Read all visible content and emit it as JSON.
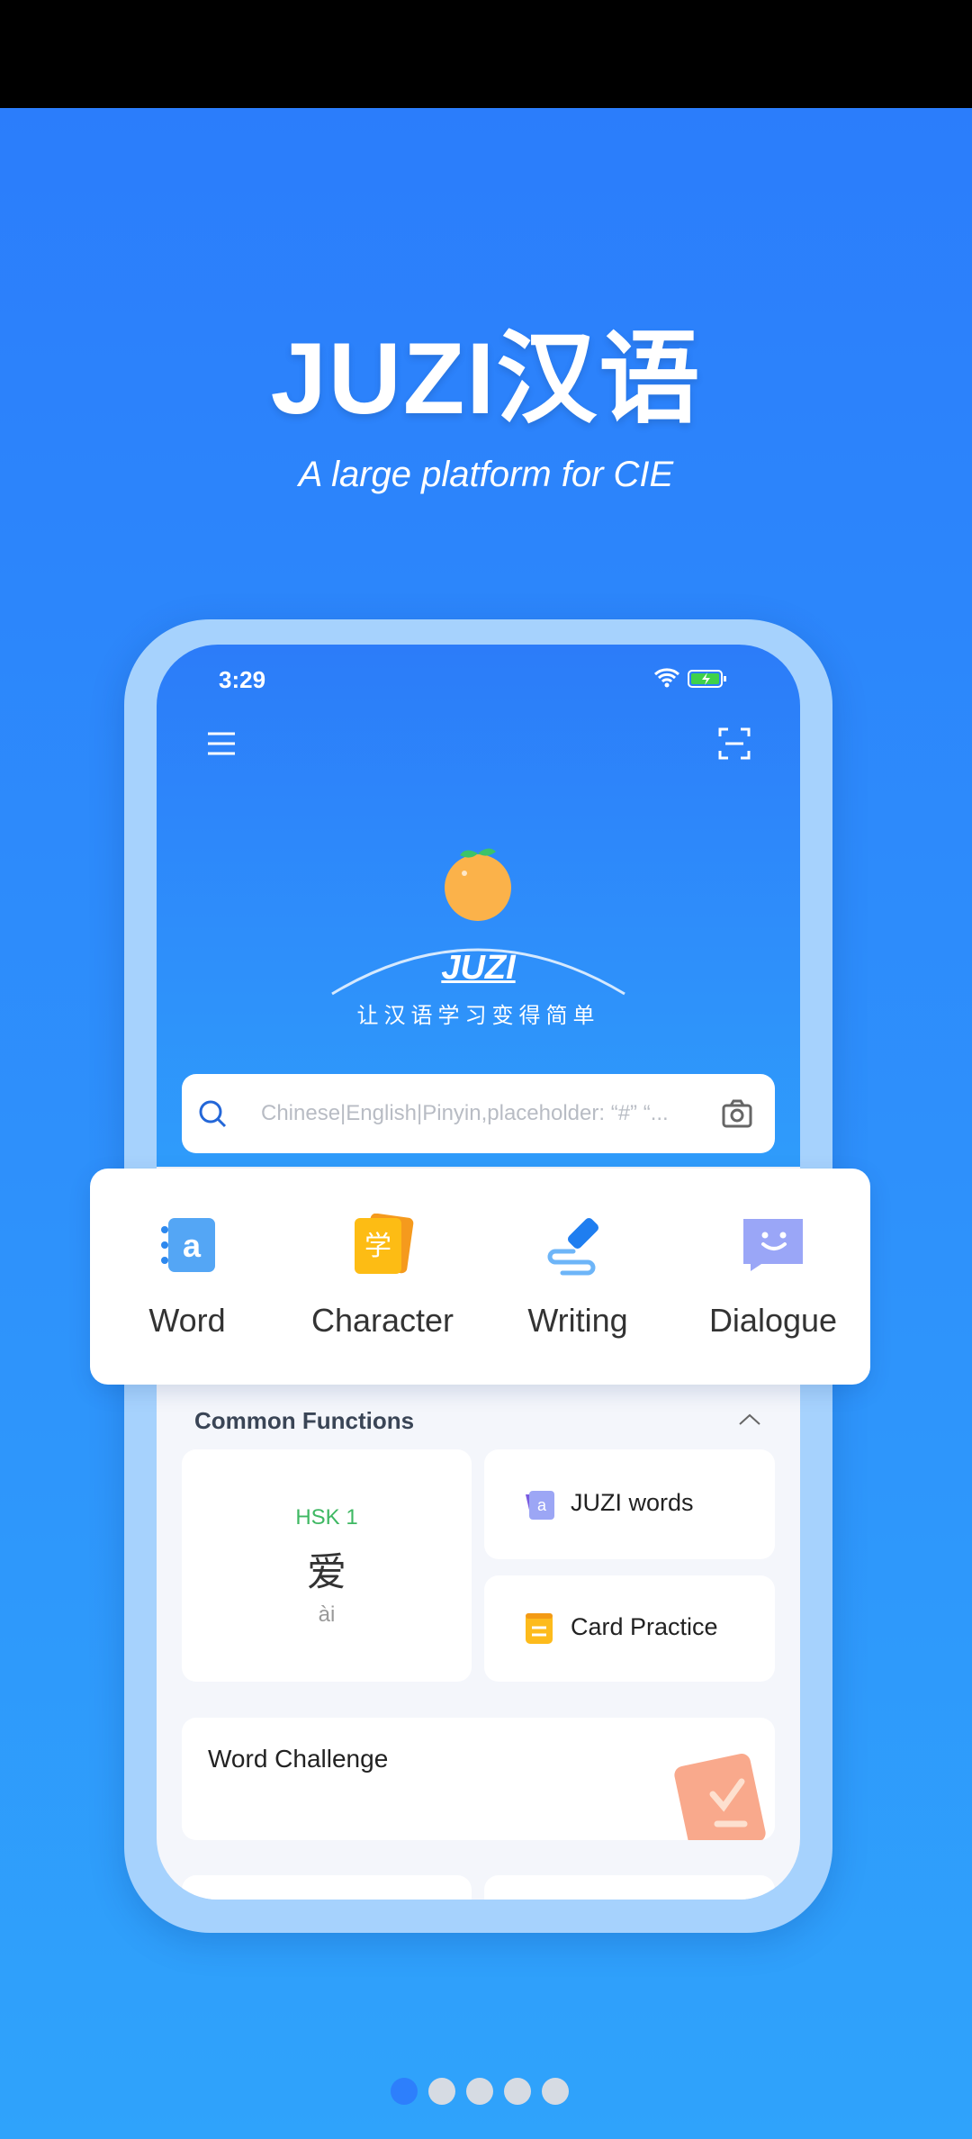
{
  "banner": {
    "title": "JUZI汉语",
    "subtitle": "A large platform for CIE"
  },
  "status": {
    "time": "3:29"
  },
  "app": {
    "logo_text": "JUZI",
    "tagline": "让汉语学习变得简单",
    "search": {
      "placeholder": "Chinese|English|Pinyin,placeholder: “#” “..."
    },
    "features": [
      {
        "label": "Word",
        "icon": "word-book-icon"
      },
      {
        "label": "Character",
        "icon": "character-cards-icon"
      },
      {
        "label": "Writing",
        "icon": "pen-writing-icon"
      },
      {
        "label": "Dialogue",
        "icon": "chat-smile-icon"
      }
    ],
    "common_functions": {
      "title": "Common Functions",
      "hsk": {
        "level": "HSK 1",
        "char": "爱",
        "pinyin": "ài"
      },
      "items": [
        {
          "label": "JUZI words"
        },
        {
          "label": "Card Practice"
        }
      ],
      "challenge": {
        "label": "Word Challenge"
      }
    }
  },
  "pager": {
    "count": 5,
    "active": 0,
    "active_color": "#2d7ffc"
  }
}
